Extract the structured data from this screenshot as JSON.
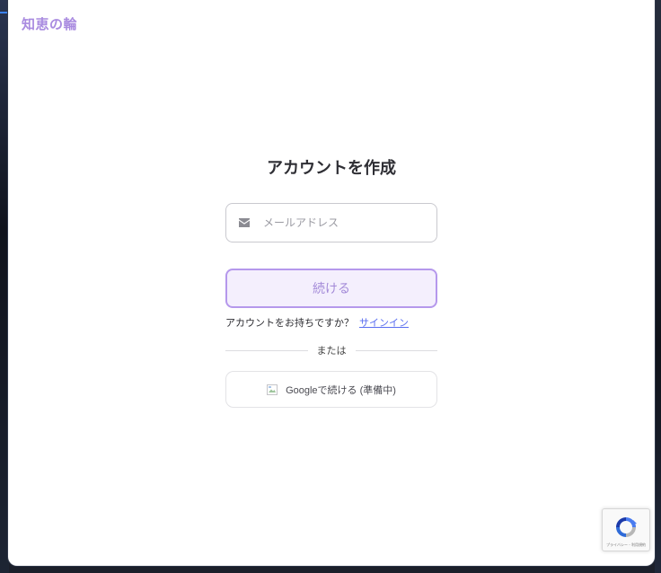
{
  "brand": {
    "name": "知恵の輪",
    "color": "#a98be0"
  },
  "signup": {
    "title": "アカウントを作成",
    "email_placeholder": "メールアドレス",
    "email_icon": "envelope-icon",
    "continue_label": "続ける",
    "have_account_text": "アカウントをお持ちですか？",
    "signin_link": "サインイン",
    "divider_text": "または",
    "google_label": "Googleで続ける (準備中)",
    "google_icon": "broken-image-icon"
  },
  "recaptcha": {
    "icon": "recaptcha-icon",
    "footer": "プライバシー - 利用規約"
  },
  "colors": {
    "accent": "#b598ec",
    "accent_bg": "#f4effd",
    "link": "#5a6ef0"
  }
}
